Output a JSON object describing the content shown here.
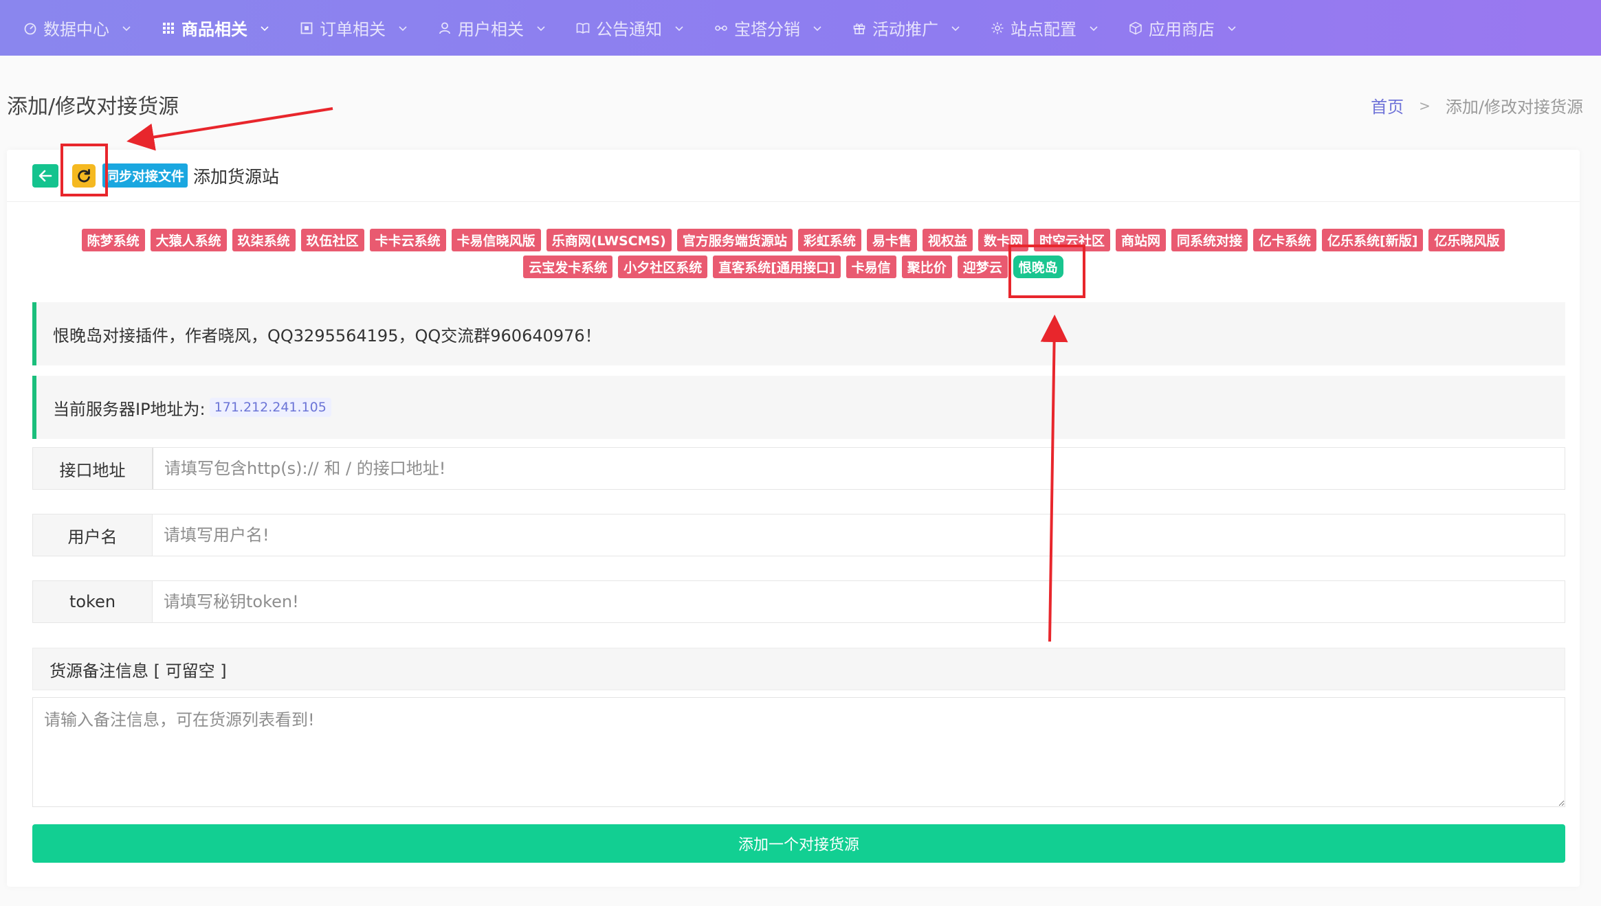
{
  "nav": {
    "items": [
      {
        "label": "数据中心",
        "icon": "dashboard-icon"
      },
      {
        "label": "商品相关",
        "icon": "grid-icon"
      },
      {
        "label": "订单相关",
        "icon": "order-icon"
      },
      {
        "label": "用户相关",
        "icon": "user-icon"
      },
      {
        "label": "公告通知",
        "icon": "book-icon"
      },
      {
        "label": "宝塔分销",
        "icon": "share-icon"
      },
      {
        "label": "活动推广",
        "icon": "gift-icon"
      },
      {
        "label": "站点配置",
        "icon": "gear-icon"
      },
      {
        "label": "应用商店",
        "icon": "cube-icon"
      }
    ],
    "active_index": 1
  },
  "page": {
    "title": "添加/修改对接货源"
  },
  "breadcrumb": {
    "home": "首页",
    "separator": ">",
    "current": "添加/修改对接货源"
  },
  "card": {
    "sync_label": "同步对接文件",
    "header_title": "添加货源站"
  },
  "tags": {
    "row1": [
      "陈梦系统",
      "大猿人系统",
      "玖柒系统",
      "玖伍社区",
      "卡卡云系统",
      "卡易信晓风版",
      "乐商网(LWSCMS)",
      "官方服务端货源站",
      "彩虹系统",
      "易卡售",
      "视权益",
      "数卡网",
      "时空云社区",
      "商站网",
      "同系统对接",
      "亿卡系统",
      "亿乐系统[新版]",
      "亿乐晓风版"
    ],
    "row2": [
      "云宝发卡系统",
      "小夕社区系统",
      "直客系统[通用接口]",
      "卡易信",
      "聚比价",
      "迎梦云",
      "恨晚岛"
    ],
    "active": "恨晚岛"
  },
  "notices": {
    "plugin_info": "恨晚岛对接插件，作者晓风，QQ3295564195，QQ交流群960640976！",
    "ip_label": "当前服务器IP地址为:",
    "ip_value": "171.212.241.105"
  },
  "form": {
    "api_label": "接口地址",
    "api_placeholder": "请填写包含http(s):// 和 / 的接口地址!",
    "username_label": "用户名",
    "username_placeholder": "请填写用户名!",
    "token_label": "token",
    "token_placeholder": "请填写秘钥token!",
    "remark_label": "货源备注信息 [ 可留空 ]",
    "remark_placeholder": "请输入备注信息，可在货源列表看到!",
    "submit_label": "添加一个对接货源"
  },
  "colors": {
    "nav_gradient_start": "#8a86ee",
    "nav_gradient_end": "#9a78f0",
    "tag_red": "#e95a70",
    "tag_active_green": "#19c58f",
    "submit_green": "#12cf92",
    "notice_border_green": "#1bbf7c",
    "annotation_red": "#e8262c",
    "refresh_yellow": "#f5b921",
    "sync_blue": "#1aa7e0"
  }
}
